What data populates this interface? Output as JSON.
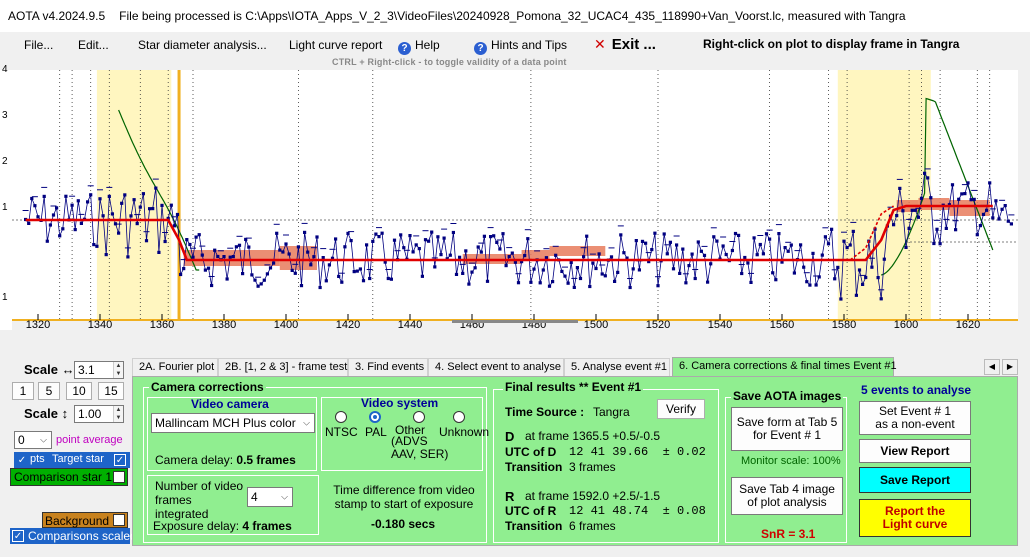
{
  "window": {
    "app": "AOTA v4.2024.9.5",
    "file_text": "File being processed is C:\\Apps\\IOTA_Apps_V_2_3\\VideoFiles\\20240928_Pomona_32_UCAC4_435_118990+Van_Voorst.lc, measured with Tangra"
  },
  "menu": {
    "file": "File...",
    "edit": "Edit...",
    "star_diameter": "Star diameter analysis...",
    "light_curve_report": "Light curve report",
    "help": "Help",
    "hints": "Hints and Tips",
    "exit": "Exit ...",
    "right_click_hint": "Right-click on plot to display frame in Tangra",
    "ctrl_hint": "CTRL + Right-click  -  to toggle validity of a data point"
  },
  "plot": {
    "y_ticks": [
      "4",
      "3",
      "2",
      "1",
      "1"
    ],
    "x_ticks": [
      "1320",
      "1340",
      "1360",
      "1380",
      "1400",
      "1420",
      "1440",
      "1460",
      "1480",
      "1500",
      "1520",
      "1540",
      "1560",
      "1580",
      "1600",
      "1620"
    ],
    "colors": {
      "data": "#000080",
      "model": "#e00000",
      "highlight": "#fff6c0",
      "baseline_box": "#e87b5c",
      "envelope": "#006400",
      "event_line": "#f0b020"
    }
  },
  "left_panel": {
    "scale_h_label": "Scale ↔",
    "scale_h_value": "3.1",
    "scale_buttons": [
      "1",
      "5",
      "10",
      "15"
    ],
    "scale_v_label": "Scale ↕",
    "scale_v_value": "1.00",
    "point_avg_value": "0",
    "point_avg_label": "point average",
    "pts_label": "pts",
    "target_star_label": "Target star",
    "comparison_star_label": "Comparison star 1",
    "background_label": "Background",
    "comparisons_scaled_label": "Comparisons scaled"
  },
  "tabs": [
    "2A. Fourier plot",
    "2B. [1, 2 & 3] - frame test",
    "3. Find events",
    "4. Select event to analyse",
    "5. Analyse event #1",
    "6. Camera corrections & final times  Event #1"
  ],
  "camera": {
    "group_title": "Camera corrections",
    "video_camera_title": "Video camera",
    "camera_model": "Mallincam MCH Plus color",
    "camera_delay_label": "Camera delay:",
    "camera_delay_value": "0.5 frames",
    "video_system_title": "Video system",
    "systems": [
      "NTSC",
      "PAL",
      "Other",
      "Unknown"
    ],
    "other_note": "(ADVS\nAAV, SER)",
    "frames_integrated_label": "Number of video frames integrated",
    "frames_integrated_value": "4",
    "exposure_delay_label": "Exposure delay:",
    "exposure_delay_value": "4 frames",
    "time_diff_label": "Time difference from video stamp to start of exposure",
    "time_diff_value": "-0.180 secs"
  },
  "results": {
    "title": "Final results  **  Event #1",
    "time_source_label": "Time Source :",
    "time_source_value": "Tangra",
    "verify": "Verify",
    "d_label": "D",
    "d_frame": "at frame 1365.5  +0.5/-0.5",
    "utc_d_label": "UTC of D",
    "utc_d_value": "12 41 39.66  ± 0.02",
    "transition_label": "Transition",
    "d_transition": "3 frames",
    "r_label": "R",
    "r_frame": "at frame 1592.0  +2.5/-1.5",
    "utc_r_label": "UTC of R",
    "utc_r_value": "12 41 48.74  ± 0.08",
    "r_transition": "6 frames"
  },
  "save": {
    "title": "Save AOTA images",
    "save_form": "Save form at Tab 5\nfor Event # 1",
    "monitor_scale": "Monitor scale: 100%",
    "save_tab4": "Save Tab 4 image\nof plot analysis",
    "snr": "SnR = 3.1"
  },
  "events": {
    "title": "5  events to analyse",
    "set_non_event": "Set Event # 1\nas a non-event",
    "view_report": "View Report",
    "save_report": "Save Report",
    "report_curve": "Report the\nLight curve"
  }
}
